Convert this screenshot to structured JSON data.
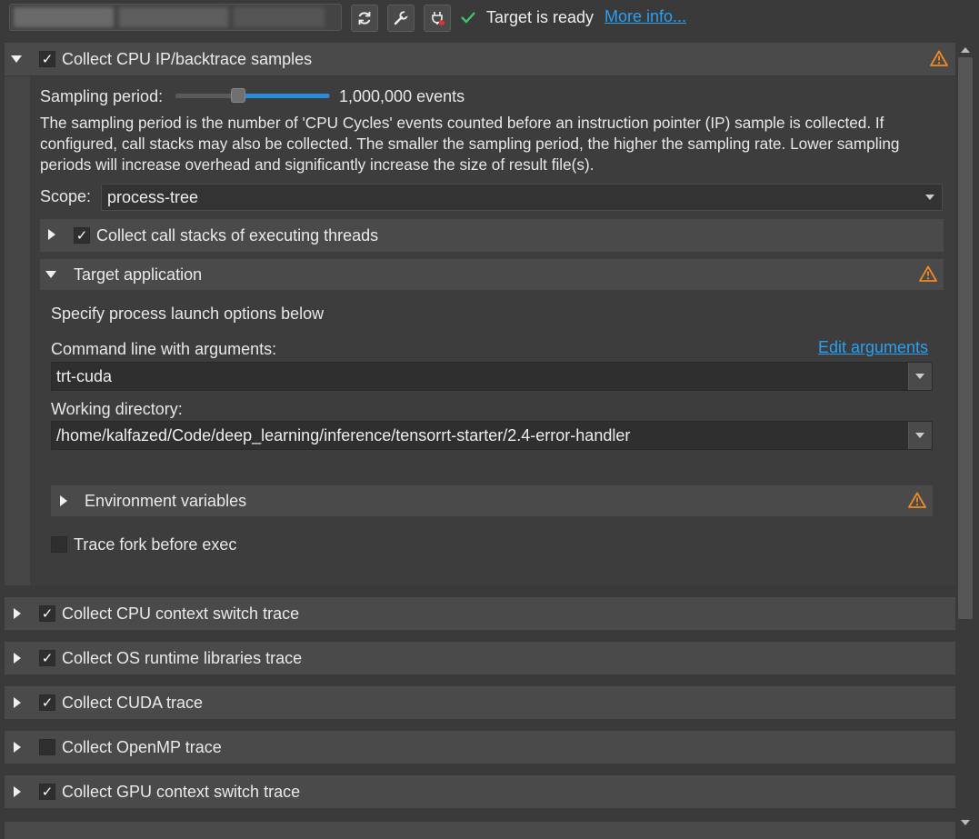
{
  "toolbar": {
    "status_text": "Target is ready",
    "more_info": "More info...",
    "buttons": [
      {
        "name": "refresh-button",
        "icon": "refresh-icon"
      },
      {
        "name": "configure-button",
        "icon": "wrench-icon"
      },
      {
        "name": "connect-button",
        "icon": "plug-icon"
      }
    ]
  },
  "cpu_samples": {
    "label": "Collect CPU IP/backtrace samples",
    "checked": true,
    "expanded": true,
    "sampling_label": "Sampling period:",
    "sampling_value": "1,000,000 events",
    "sampling_level": 0.4,
    "description": "The sampling period is the number of 'CPU Cycles' events counted before an instruction pointer (IP) sample is collected. If configured, call stacks may also be collected. The smaller the sampling period, the higher the sampling rate. Lower sampling periods will increase overhead and significantly increase the size of result file(s).",
    "scope_label": "Scope:",
    "scope_value": "process-tree",
    "call_stacks_label": "Collect call stacks of executing threads",
    "target_app": {
      "label": "Target application",
      "intro": "Specify process launch options below",
      "cmd_label": "Command line with arguments:",
      "edit_args": "Edit arguments",
      "cmd_value": "trt-cuda",
      "wd_label": "Working directory:",
      "wd_value": "/home/kalfazed/Code/deep_learning/inference/tensorrt-starter/2.4-error-handler",
      "env_label": "Environment variables",
      "trace_fork_label": "Trace fork before exec"
    }
  },
  "rows": [
    {
      "label": "Collect CPU context switch trace",
      "checked": true
    },
    {
      "label": "Collect OS runtime libraries trace",
      "checked": true
    },
    {
      "label": "Collect CUDA trace",
      "checked": true
    },
    {
      "label": "Collect OpenMP trace",
      "checked": false
    },
    {
      "label": "Collect GPU context switch trace",
      "checked": true
    }
  ],
  "colors": {
    "accent": "#2aa0f0",
    "warning": "#f08a24",
    "ready_check": "#3ec46d"
  },
  "check_glyph": "✓"
}
